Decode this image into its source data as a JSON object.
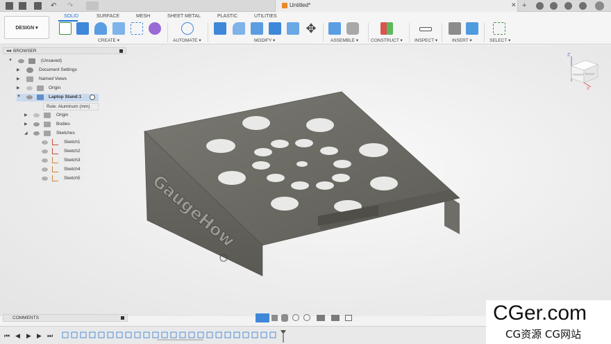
{
  "title_bar": {
    "document_title": "Untitled*"
  },
  "workspace": {
    "design_label": "DESIGN ▾"
  },
  "tabs": [
    {
      "label": "SOLID",
      "active": true
    },
    {
      "label": "SURFACE",
      "active": false
    },
    {
      "label": "MESH",
      "active": false
    },
    {
      "label": "SHEET METAL",
      "active": false
    },
    {
      "label": "PLASTIC",
      "active": false
    },
    {
      "label": "UTILITIES",
      "active": false
    }
  ],
  "groups": {
    "create": "CREATE ▾",
    "automate": "AUTOMATE ▾",
    "modify": "MODIFY ▾",
    "assemble": "ASSEMBLE ▾",
    "construct": "CONSTRUCT ▾",
    "inspect": "INSPECT ▾",
    "insert": "INSERT ▾",
    "select": "SELECT ▾"
  },
  "browser": {
    "title": "BROWSER",
    "rows": [
      {
        "label": "(Unsaved)"
      },
      {
        "label": "Document Settings"
      },
      {
        "label": "Named Views"
      },
      {
        "label": "Origin"
      },
      {
        "label": "Laptop Stand:1"
      },
      {
        "label": "Rule: Aluminum (mm)"
      },
      {
        "label": "Origin"
      },
      {
        "label": "Bodies"
      },
      {
        "label": "Sketches"
      },
      {
        "label": "Sketch1"
      },
      {
        "label": "Sketch2"
      },
      {
        "label": "Sketch3"
      },
      {
        "label": "Sketch4"
      },
      {
        "label": "Sketch5"
      }
    ]
  },
  "viewcube": {
    "front": "FRONT",
    "right": "RIGHT",
    "axis_z": "Z",
    "axis_x": "X"
  },
  "model": {
    "engraved_text": "GaugeHow"
  },
  "comments": {
    "label": "COMMENTS"
  },
  "watermark": {
    "main": "CGer.com",
    "sub": "CG资源 CG网站"
  },
  "colors": {
    "accent": "#1a73d6",
    "metal": "#6b6a64",
    "metal_dark": "#55544f"
  }
}
